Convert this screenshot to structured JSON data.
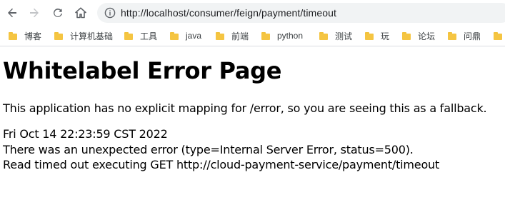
{
  "browser": {
    "back_icon": "arrow-left-icon",
    "forward_icon": "arrow-right-icon",
    "reload_icon": "reload-icon",
    "home_icon": "home-icon",
    "info_icon": "info-icon",
    "url": "http://localhost/consumer/feign/payment/timeout",
    "omnibox_bg": "#f1f3f4"
  },
  "bookmarks": [
    {
      "label": "博客"
    },
    {
      "label": "计算机基础"
    },
    {
      "label": "工具"
    },
    {
      "label": "java"
    },
    {
      "label": "前端"
    },
    {
      "label": "python"
    },
    {
      "label": "测试"
    },
    {
      "label": "玩"
    },
    {
      "label": "论坛"
    },
    {
      "label": "问鼎"
    },
    {
      "label": ""
    }
  ],
  "page": {
    "title": "Whitelabel Error Page",
    "message": "This application has no explicit mapping for /error, so you are seeing this as a fallback.",
    "timestamp": "Fri Oct 14 22:23:59 CST 2022",
    "error_line": "There was an unexpected error (type=Internal Server Error, status=500).",
    "detail_line": "Read timed out executing GET http://cloud-payment-service/payment/timeout"
  }
}
